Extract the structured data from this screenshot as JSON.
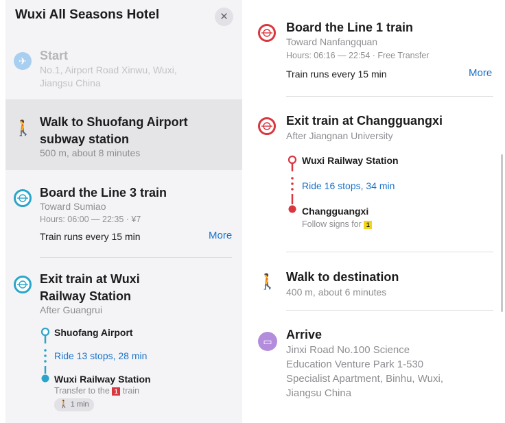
{
  "header": {
    "title": "Wuxi All Seasons Hotel",
    "close_glyph": "✕"
  },
  "start": {
    "title": "Start",
    "address": "No.1, Airport Road Xinwu, Wuxi,",
    "address2": "Jiangsu China",
    "icon": "airplane-icon"
  },
  "walk1": {
    "title_line1": "Walk to Shuofang Airport",
    "title_line2": "subway station",
    "detail": "500 m, about 8 minutes",
    "icon": "pedestrian-icon"
  },
  "board3": {
    "title": "Board the Line 3 train",
    "toward": "Toward Sumiao",
    "hours": "Hours: 06:00 — 22:35 · ¥7",
    "frequency": "Train runs every 15 min",
    "more": "More",
    "line_color": "#2aa5c9"
  },
  "exit3": {
    "title_line1": "Exit train at Wuxi",
    "title_line2": "Railway Station",
    "after": "After Guangrui",
    "from_stop": "Shuofang Airport",
    "ride": "Ride 13 stops, 28 min",
    "to_stop": "Wuxi Railway Station",
    "transfer_prefix": "Transfer to the",
    "transfer_line": "1",
    "transfer_suffix": "train",
    "walk_chip": "1 min"
  },
  "board1": {
    "title": "Board the Line 1 train",
    "toward": "Toward Nanfangquan",
    "hours": "Hours: 06:16 — 22:54 · Free Transfer",
    "frequency": "Train runs every 15 min",
    "more": "More",
    "line_color": "#d9363e"
  },
  "exit1": {
    "title": "Exit train at Changguangxi",
    "after": "After Jiangnan University",
    "from_stop": "Wuxi Railway Station",
    "ride": "Ride 16 stops, 34 min",
    "to_stop": "Changguangxi",
    "signs_prefix": "Follow signs for",
    "signs_exit": "1"
  },
  "walk2": {
    "title": "Walk to destination",
    "detail": "400 m, about 6 minutes",
    "icon": "pedestrian-icon"
  },
  "arrive": {
    "title": "Arrive",
    "address_line1": "Jinxi Road No.100 Science",
    "address_line2": "Education Venture Park 1-530",
    "address_line3": "Specialist Apartment, Binhu, Wuxi,",
    "address_line4": "Jiangsu China",
    "icon": "bed-icon",
    "color": "#b38ddc"
  }
}
